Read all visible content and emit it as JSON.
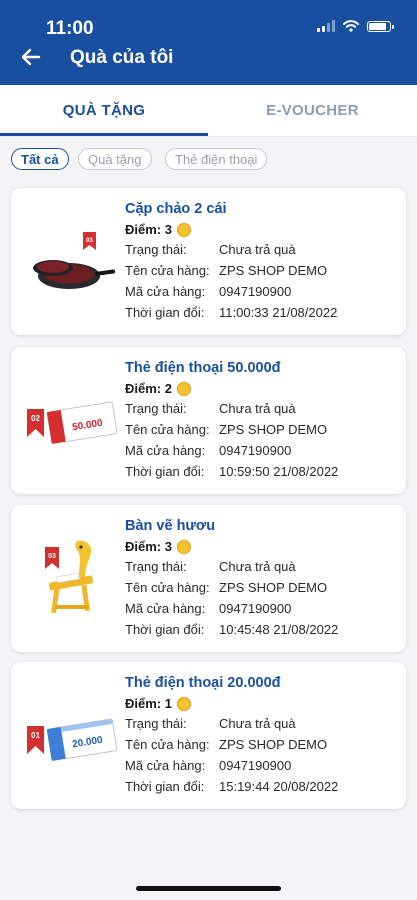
{
  "status_bar": {
    "time": "11:00"
  },
  "header": {
    "title": "Quà của tôi"
  },
  "tabs": [
    {
      "label": "QUÀ TẶNG"
    },
    {
      "label": "E-VOUCHER"
    }
  ],
  "filters": [
    {
      "label": "Tất cả"
    },
    {
      "label": "Quà tặng"
    },
    {
      "label": "Thẻ điện thoại"
    }
  ],
  "labels": {
    "points": "Điểm:",
    "status": "Trạng thái:",
    "store_name": "Tên cửa hàng:",
    "store_code": "Mã cửa hàng:",
    "redeem_time": "Thời gian đổi:"
  },
  "gifts": [
    {
      "name": "Cặp chảo 2 cái",
      "points": "3",
      "status": "Chưa trả quà",
      "store_name": "ZPS SHOP DEMO",
      "store_code": "0947190900",
      "redeem_time": "11:00:33 21/08/2022",
      "badge": "03"
    },
    {
      "name": "Thẻ điện thoại 50.000đ",
      "points": "2",
      "status": "Chưa trả quà",
      "store_name": "ZPS SHOP DEMO",
      "store_code": "0947190900",
      "redeem_time": "10:59:50 21/08/2022",
      "badge": "02",
      "card_value": "50.000"
    },
    {
      "name": "Bàn vẽ hươu",
      "points": "3",
      "status": "Chưa trả quà",
      "store_name": "ZPS SHOP DEMO",
      "store_code": "0947190900",
      "redeem_time": "10:45:48 21/08/2022",
      "badge": "03"
    },
    {
      "name": "Thẻ điện thoại 20.000đ",
      "points": "1",
      "status": "Chưa trả quà",
      "store_name": "ZPS SHOP DEMO",
      "store_code": "0947190900",
      "redeem_time": "15:19:44 20/08/2022",
      "badge": "01",
      "card_value": "20.000"
    }
  ],
  "colors": {
    "primary": "#1a4fa0",
    "coin": "#f5c330",
    "badge": "#d42f2f"
  }
}
